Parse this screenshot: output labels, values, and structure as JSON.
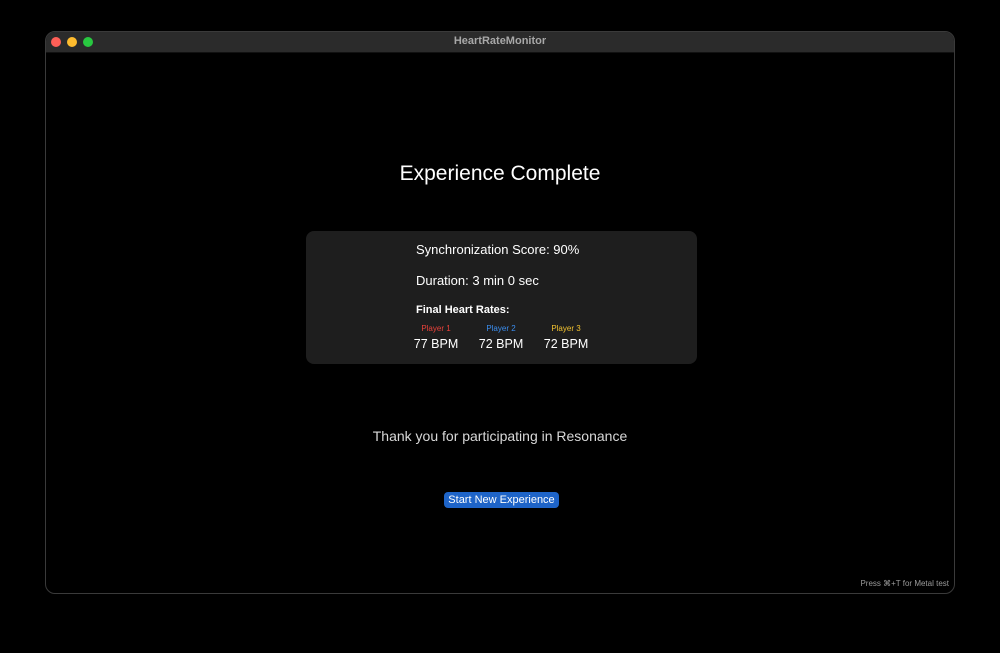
{
  "window": {
    "title": "HeartRateMonitor"
  },
  "main": {
    "heading": "Experience Complete",
    "sync_score": "Synchronization Score: 90%",
    "duration": "Duration: 3 min 0 sec",
    "final_rates_heading": "Final Heart Rates:",
    "players": [
      {
        "name": "Player 1",
        "bpm": "77 BPM",
        "color": "#e8423a"
      },
      {
        "name": "Player 2",
        "bpm": "72 BPM",
        "color": "#3b8ef0"
      },
      {
        "name": "Player 3",
        "bpm": "72 BPM",
        "color": "#f2c230"
      }
    ],
    "thanks": "Thank you for participating in Resonance",
    "start_button": "Start New Experience",
    "hint": "Press ⌘+T for Metal test"
  },
  "colors": {
    "background": "#000000",
    "card": "#1e1e1e",
    "accent": "#1e64c8"
  }
}
